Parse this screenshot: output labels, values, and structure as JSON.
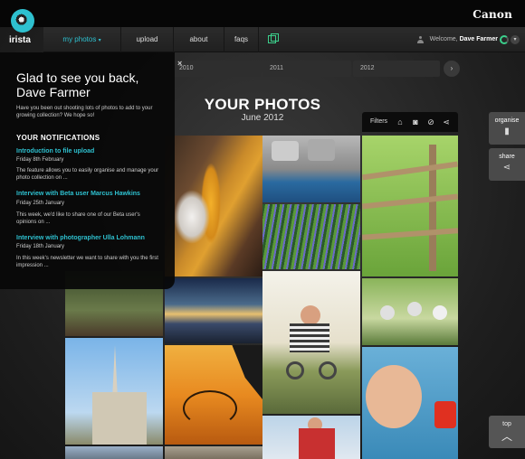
{
  "brand": {
    "logo_text": "irista",
    "partner": "Canon"
  },
  "nav": {
    "items": [
      {
        "label": "my photos",
        "active": true
      },
      {
        "label": "upload"
      },
      {
        "label": "about"
      },
      {
        "label": "faqs"
      }
    ],
    "caret": "▾",
    "welcome_prefix": "Welcome,",
    "user_name": "Dave Farmer"
  },
  "timeline": {
    "years": [
      "2010",
      "2011",
      "2012"
    ],
    "next": "›"
  },
  "page": {
    "title": "YOUR PHOTOS",
    "subtitle": "June 2012"
  },
  "filters": {
    "label": "Filters",
    "icons": [
      "tag-icon",
      "camera-icon",
      "block-icon",
      "share-icon"
    ]
  },
  "side": {
    "organise": "organise",
    "share": "share",
    "top": "top"
  },
  "welcome_panel": {
    "close": "×",
    "title": "Glad to see you back, Dave Farmer",
    "intro": "Have you been out shooting lots of photos to add to your growing collection? We hope so!",
    "notifications_heading": "YOUR NOTIFICATIONS",
    "notifications": [
      {
        "title": "Introduction to file upload",
        "date": "Friday 8th February",
        "body": "The feature allows you to easily organise and manage your photo collection on ..."
      },
      {
        "title": "Interview with Beta user Marcus Hawkins",
        "date": "Friday 25th January",
        "body": "This week, we'd like to share one of our Beta user's opinions on ..."
      },
      {
        "title": "Interview with photographer Ulla Lohmann",
        "date": "Friday 18th January",
        "body": "In this week's newsletter we want to share with you the first impression ..."
      }
    ]
  },
  "colors": {
    "accent": "#2ec0cf",
    "green": "#3bd08c"
  }
}
